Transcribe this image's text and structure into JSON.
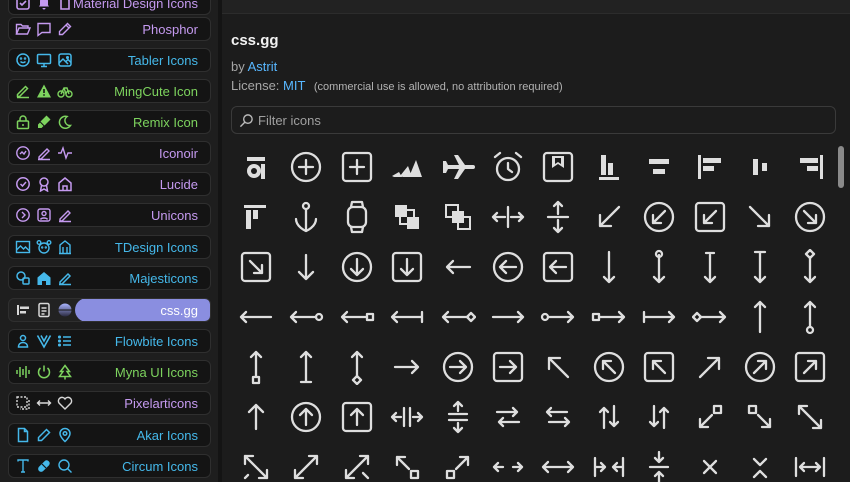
{
  "sidebar": {
    "accent_color": "#8a8ee0",
    "items": [
      {
        "label": "Material Design Icons",
        "color": "#c59af0",
        "icons": [
          "checkbox-icon",
          "bell-icon",
          "file-icon"
        ]
      },
      {
        "label": "Phosphor",
        "color": "#c59af0",
        "icons": [
          "folder-open-icon",
          "chat-square-icon",
          "pencil-icon"
        ]
      },
      {
        "label": "Tabler Icons",
        "color": "#45b8ea",
        "icons": [
          "mood-smile-icon",
          "monitor-icon",
          "photo-icon"
        ]
      },
      {
        "label": "MingCute Icon",
        "color": "#7dd35e",
        "icons": [
          "edit-icon",
          "warning-icon",
          "bike-icon"
        ]
      },
      {
        "label": "Remix Icon",
        "color": "#7dd35e",
        "icons": [
          "lock-icon",
          "highlighter-icon",
          "moon-icon"
        ]
      },
      {
        "label": "Iconoir",
        "color": "#c59af0",
        "icons": [
          "chat-bubble-icon",
          "edit-pencil-icon",
          "activity-icon"
        ]
      },
      {
        "label": "Lucide",
        "color": "#c59af0",
        "icons": [
          "circle-check-icon",
          "award-icon",
          "home-icon"
        ]
      },
      {
        "label": "Unicons",
        "color": "#c59af0",
        "icons": [
          "arrow-circle-right-icon",
          "user-square-icon",
          "pen-icon"
        ]
      },
      {
        "label": "TDesign Icons",
        "color": "#45b8ea",
        "icons": [
          "image-icon",
          "animal-face-icon",
          "building-icon"
        ]
      },
      {
        "label": "Majesticons",
        "color": "#45b8ea",
        "icons": [
          "shapes-icon",
          "home-icon",
          "edit-pen-icon"
        ]
      },
      {
        "label": "css.gg",
        "color": "#ffffff",
        "icons": [
          "align-icon",
          "file-document-icon",
          "globe-icon"
        ],
        "selected": true
      },
      {
        "label": "Flowbite Icons",
        "color": "#45b8ea",
        "icons": [
          "user-icon",
          "vuejs-icon",
          "list-icon"
        ]
      },
      {
        "label": "Myna UI Icons",
        "color": "#7dd35e",
        "icons": [
          "waveform-icon",
          "power-icon",
          "tree-icon"
        ]
      },
      {
        "label": "Pixelarticons",
        "color": "#c59af0",
        "icons": [
          "grid-dotted-icon",
          "swap-icon",
          "heart-icon"
        ]
      },
      {
        "label": "Akar Icons",
        "color": "#45b8ea",
        "icons": [
          "file-icon",
          "pencil-icon",
          "location-icon"
        ]
      },
      {
        "label": "Circum Icons",
        "color": "#45b8ea",
        "icons": [
          "text-icon",
          "pill-icon",
          "zoom-icon"
        ]
      }
    ]
  },
  "main": {
    "title": "css.gg",
    "by_prefix": "by",
    "author": "Astrit",
    "license_prefix": "License:",
    "license_name": "MIT",
    "license_note": "(commercial use is allowed, no attribution required)",
    "filter_placeholder": "Filter icons",
    "icons": [
      [
        "abstract-icon",
        "add-icon",
        "add-r-icon",
        "adidas-icon",
        "airplane-icon",
        "alarm-icon",
        "album-icon",
        "align-bottom-icon",
        "align-center-icon",
        "align-left-icon",
        "align-middle-icon",
        "align-right-icon"
      ],
      [
        "align-top-icon",
        "anchor-icon",
        "apple-watch-icon",
        "arrange-back-icon",
        "arrange-front-icon",
        "arrow-align-h-icon",
        "arrow-align-v-icon",
        "arrow-bottom-left-icon",
        "arrow-bottom-left-o-icon",
        "arrow-bottom-left-r-icon",
        "arrow-bottom-right-icon",
        "arrow-bottom-right-o-icon"
      ],
      [
        "arrow-bottom-right-r-icon",
        "arrow-down-icon",
        "arrow-down-o-icon",
        "arrow-down-r-icon",
        "arrow-left-icon",
        "arrow-left-o-icon",
        "arrow-left-r-icon",
        "arrow-long-down-icon",
        "arrow-long-down-c-icon",
        "arrow-long-down-e-icon",
        "arrow-long-down-l-icon",
        "arrow-long-down-r-icon"
      ],
      [
        "arrow-long-left-icon",
        "arrow-long-left-c-icon",
        "arrow-long-left-e-icon",
        "arrow-long-left-l-icon",
        "arrow-long-left-r-icon",
        "arrow-long-right-icon",
        "arrow-long-right-c-icon",
        "arrow-long-right-e-icon",
        "arrow-long-right-l-icon",
        "arrow-long-right-r-icon",
        "arrow-long-up-icon",
        "arrow-long-up-c-icon"
      ],
      [
        "arrow-long-up-e-icon",
        "arrow-long-up-l-icon",
        "arrow-long-up-r-icon",
        "arrow-right-icon",
        "arrow-right-o-icon",
        "arrow-right-r-icon",
        "arrow-top-left-icon",
        "arrow-top-left-o-icon",
        "arrow-top-left-r-icon",
        "arrow-top-right-icon",
        "arrow-top-right-o-icon",
        "arrow-top-right-r-icon"
      ],
      [
        "arrow-up-icon",
        "arrow-up-o-icon",
        "arrow-up-r-icon",
        "arrows-breake-h-icon",
        "arrows-breake-v-icon",
        "arrows-exchange-icon",
        "arrows-exchange-alt-icon",
        "arrows-exchange-alt-v-icon",
        "arrows-exchange-v-icon",
        "arrows-expand-down-left-icon",
        "arrows-expand-down-right-icon",
        "arrows-expand-left-icon"
      ],
      [
        "arrows-expand-right-icon",
        "arrows-expand-up-left-icon",
        "arrows-expand-up-right-icon",
        "arrows-expand-up-alt-icon",
        "arrows-h-icon",
        "arrows-h-alt-icon",
        "arrows-merge-alt-h-icon",
        "arrows-merge-alt-v-icon",
        "arrows-merge-h-icon",
        "arrows-merge-v-icon",
        "arrows-shrink-h-icon",
        "arrows-scroll-h-icon"
      ]
    ]
  }
}
